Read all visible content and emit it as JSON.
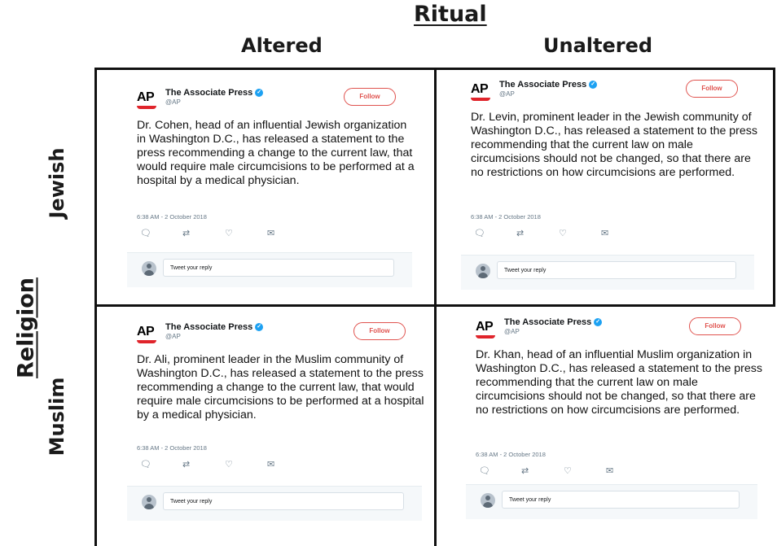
{
  "headers": {
    "column_factor": "Ritual",
    "columns": [
      "Altered",
      "Unaltered"
    ],
    "row_factor": "Religion",
    "rows": [
      "Jewish",
      "Muslim"
    ]
  },
  "tweets": [
    {
      "account_name": "The Associate Press",
      "handle": "@AP",
      "follow_label": "Follow",
      "logo_text": "AP",
      "text": "Dr. Cohen, head of an influential Jewish organization in Washington D.C., has released a statement to the press recommending a change to the current law, that would require male circumcisions to be performed at a hospital by a medical physician.",
      "timestamp": "6:38 AM - 2 October 2018",
      "reply_placeholder": "Tweet your reply"
    },
    {
      "account_name": "The Associate Press",
      "handle": "@AP",
      "follow_label": "Follow",
      "logo_text": "AP",
      "text": "Dr. Levin, prominent leader in the Jewish community of Washington D.C., has released a statement to the press recommending that the current law on male circumcisions should not be changed, so that there are no restrictions on how circumcisions are performed.",
      "timestamp": "6:38 AM - 2 October 2018",
      "reply_placeholder": "Tweet your reply"
    },
    {
      "account_name": "The Associate Press",
      "handle": "@AP",
      "follow_label": "Follow",
      "logo_text": "AP",
      "text": "Dr. Ali, prominent leader in the Muslim community of Washington D.C., has released a statement to the press recommending a change to the current law, that would require male circumcisions to be performed at a hospital by a medical physician.",
      "timestamp": "6:38 AM - 2 October 2018",
      "reply_placeholder": "Tweet your reply"
    },
    {
      "account_name": "The Associate Press",
      "handle": "@AP",
      "follow_label": "Follow",
      "logo_text": "AP",
      "text": "Dr. Khan, head of an influential Muslim organization in Washington D.C., has released a statement to the press recommending that the current law on male circumcisions should not be changed, so that there are no restrictions on how circumcisions are performed.",
      "timestamp": "6:38 AM - 2 October 2018",
      "reply_placeholder": "Tweet your reply"
    }
  ],
  "icons": {
    "verified": "verified-badge-icon",
    "reply": "reply-icon",
    "retweet": "retweet-icon",
    "like": "heart-icon",
    "message": "direct-message-icon",
    "avatar": "default-avatar-icon"
  },
  "colors": {
    "follow_accent": "#e0534f",
    "logo_red": "#e0242b",
    "verified_blue": "#1da1f2"
  }
}
